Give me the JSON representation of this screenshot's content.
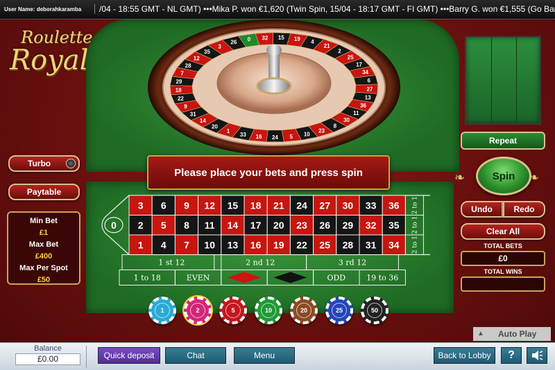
{
  "ticker": {
    "user_label": "User Name: deborahkaramba",
    "text": "/04 - 18:55 GMT - NL GMT) •••Mika P. won €1,620 (Twin Spin, 15/04 - 18:17 GMT - FI GMT) •••Barry G. won €1,555 (Go Bananas, 16/0"
  },
  "logo": {
    "line1": "Roulette",
    "line2": "Royal"
  },
  "wheel": {
    "numbers": [
      "0",
      "32",
      "15",
      "19",
      "4",
      "21",
      "2",
      "25",
      "17",
      "34",
      "6",
      "27",
      "13",
      "36",
      "11",
      "30",
      "8",
      "23",
      "10",
      "5",
      "24",
      "16",
      "33",
      "1",
      "20",
      "14",
      "31",
      "9",
      "22",
      "18",
      "29",
      "7",
      "28",
      "12",
      "35",
      "3",
      "26"
    ],
    "colors": {
      "red": "#c7150f",
      "black": "#151515",
      "green": "#1d8a2a"
    }
  },
  "message": "Please place your bets and press spin",
  "left_panel": {
    "turbo_label": "Turbo",
    "paytable_label": "Paytable",
    "min_bet_label": "Min Bet",
    "min_bet_value": "£1",
    "max_bet_label": "Max Bet",
    "max_bet_value": "£400",
    "max_spot_label": "Max Per Spot",
    "max_spot_value": "£50"
  },
  "right_panel": {
    "repeat_label": "Repeat",
    "spin_label": "Spin",
    "undo_label": "Undo",
    "redo_label": "Redo",
    "clear_label": "Clear All",
    "total_bets_label": "TOTAL BETS",
    "total_bets_value": "£0",
    "total_wins_label": "TOTAL WINS",
    "total_wins_value": "",
    "autoplay_label": "Auto Play"
  },
  "table": {
    "zero": "0",
    "rows": [
      [
        {
          "n": "3",
          "c": "red"
        },
        {
          "n": "6",
          "c": "black"
        },
        {
          "n": "9",
          "c": "red"
        },
        {
          "n": "12",
          "c": "red"
        },
        {
          "n": "15",
          "c": "black"
        },
        {
          "n": "18",
          "c": "red"
        },
        {
          "n": "21",
          "c": "red"
        },
        {
          "n": "24",
          "c": "black"
        },
        {
          "n": "27",
          "c": "red"
        },
        {
          "n": "30",
          "c": "red"
        },
        {
          "n": "33",
          "c": "black"
        },
        {
          "n": "36",
          "c": "red"
        }
      ],
      [
        {
          "n": "2",
          "c": "black"
        },
        {
          "n": "5",
          "c": "red"
        },
        {
          "n": "8",
          "c": "black"
        },
        {
          "n": "11",
          "c": "black"
        },
        {
          "n": "14",
          "c": "red"
        },
        {
          "n": "17",
          "c": "black"
        },
        {
          "n": "20",
          "c": "black"
        },
        {
          "n": "23",
          "c": "red"
        },
        {
          "n": "26",
          "c": "black"
        },
        {
          "n": "29",
          "c": "black"
        },
        {
          "n": "32",
          "c": "red"
        },
        {
          "n": "35",
          "c": "black"
        }
      ],
      [
        {
          "n": "1",
          "c": "red"
        },
        {
          "n": "4",
          "c": "black"
        },
        {
          "n": "7",
          "c": "red"
        },
        {
          "n": "10",
          "c": "black"
        },
        {
          "n": "13",
          "c": "black"
        },
        {
          "n": "16",
          "c": "red"
        },
        {
          "n": "19",
          "c": "red"
        },
        {
          "n": "22",
          "c": "black"
        },
        {
          "n": "25",
          "c": "red"
        },
        {
          "n": "28",
          "c": "black"
        },
        {
          "n": "31",
          "c": "black"
        },
        {
          "n": "34",
          "c": "red"
        }
      ]
    ],
    "column_bets": [
      "2 to 1",
      "2 to 1",
      "2 to 1"
    ],
    "dozens": [
      "1 st 12",
      "2 nd 12",
      "3 rd 12"
    ],
    "outside": [
      "1 to 18",
      "EVEN",
      "red-diamond",
      "black-diamond",
      "ODD",
      "19 to 36"
    ]
  },
  "chips": [
    {
      "value": "1",
      "color": "#29a9d8"
    },
    {
      "value": "2",
      "color": "#d6247a"
    },
    {
      "value": "5",
      "color": "#c4161c"
    },
    {
      "value": "10",
      "color": "#1f9a35"
    },
    {
      "value": "20",
      "color": "#8a4a22"
    },
    {
      "value": "25",
      "color": "#2346b8"
    },
    {
      "value": "50",
      "color": "#222222"
    }
  ],
  "bottom_bar": {
    "balance_label": "Balance",
    "balance_value": "£0.00",
    "quick_deposit": "Quick deposit",
    "chat": "Chat",
    "menu": "Menu",
    "back_to_lobby": "Back to Lobby",
    "help": "?",
    "sound_icon": "speaker-icon"
  }
}
